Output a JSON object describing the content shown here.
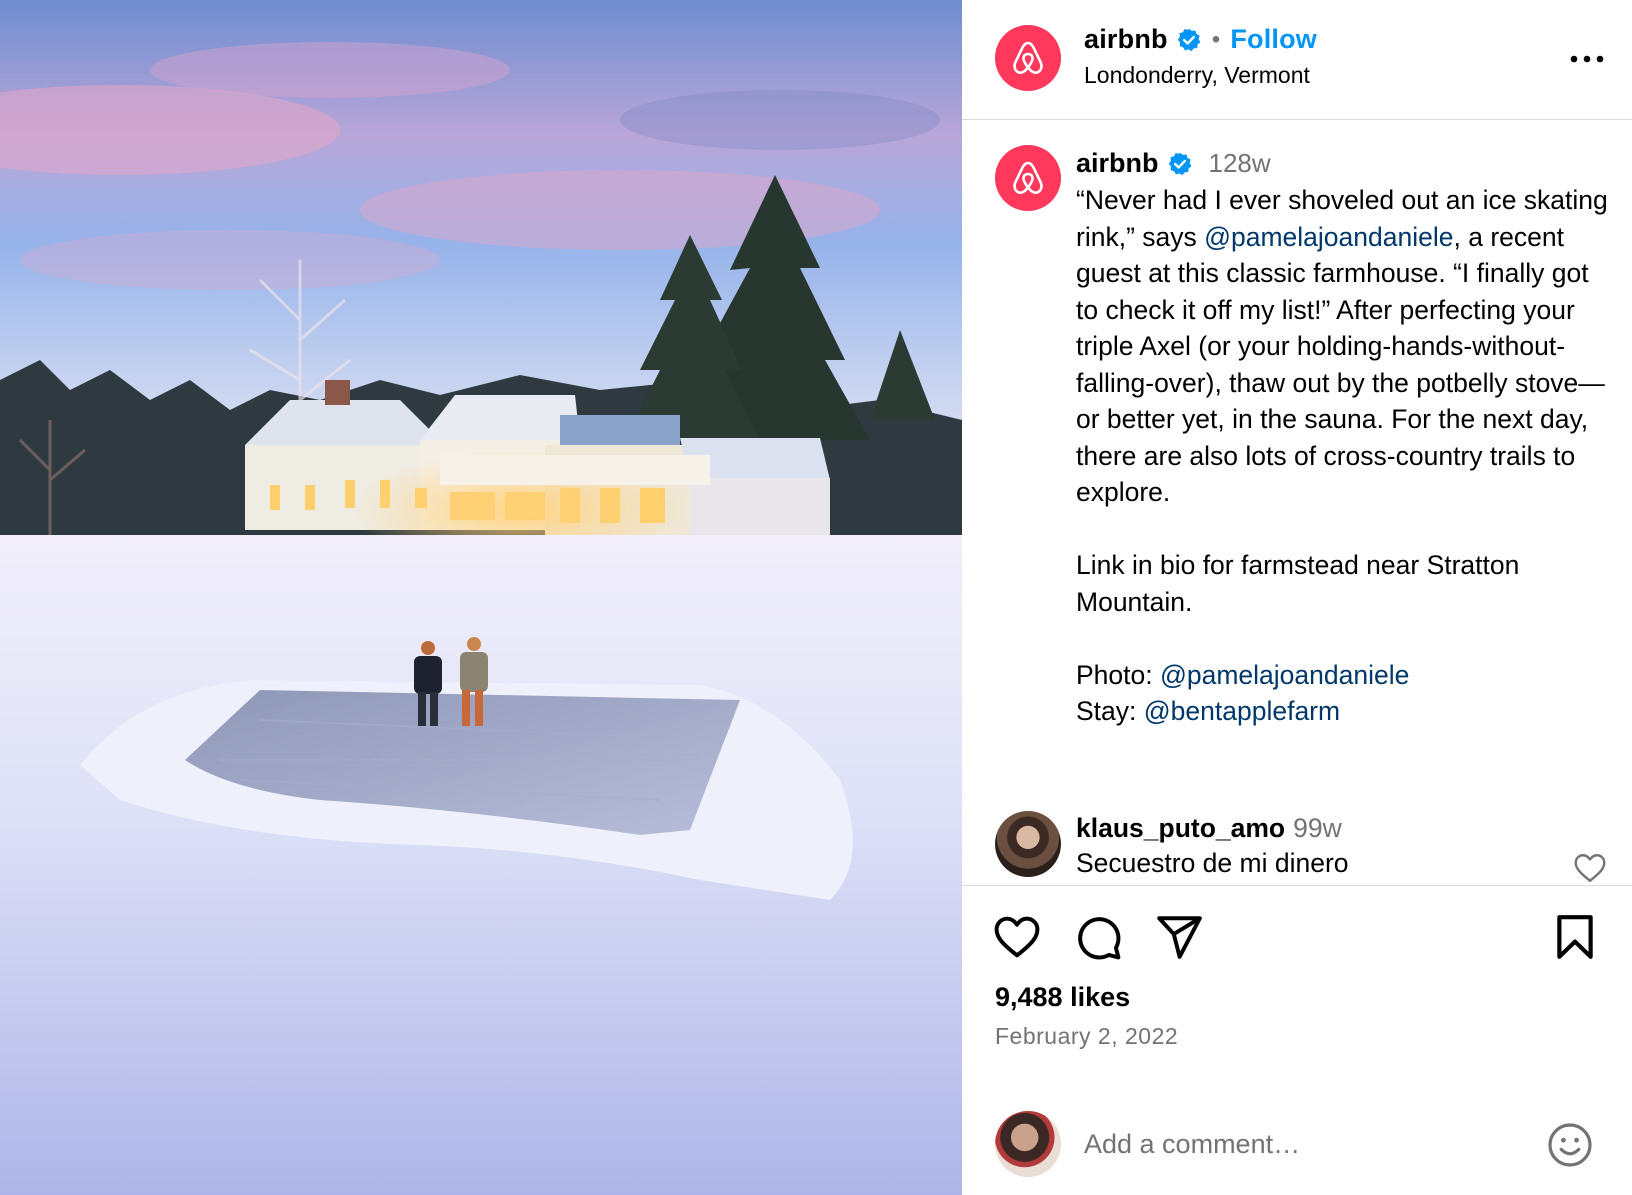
{
  "post": {
    "account": "airbnb",
    "follow_label": "Follow",
    "location": "Londonderry, Vermont",
    "separator": "•"
  },
  "caption": {
    "account": "airbnb",
    "time": "128w",
    "text_part1": "“Never had I ever shoveled out an ice skating rink,” says ",
    "mention1": "@pamelajoandaniele",
    "text_part2": ", a recent guest at this classic farmhouse. “I finally got to check it off my list!” After perfecting your triple Axel (or your holding-hands-without-falling-over), thaw out by the potbelly stove—or better yet, in the sauna. For the next day, there are also lots of cross-country trails to explore.\n\nLink in bio for farmstead near Stratton Mountain.\n\nPhoto: ",
    "mention2": "@pamelajoandaniele",
    "text_part3": "\nStay: ",
    "mention3": "@bentapplefarm"
  },
  "comment": {
    "user": "klaus_puto_amo",
    "time": "99w",
    "text": "Secuestro de mi dinero"
  },
  "stats": {
    "likes": "9,488 likes",
    "date": "February 2, 2022"
  },
  "composer": {
    "placeholder": "Add a comment…"
  },
  "colors": {
    "brand": "#ff385c",
    "link_blue": "#0095f6",
    "mention": "#00376b",
    "muted": "#737373"
  },
  "icons": {
    "header_more": "more-icon",
    "verified": "verified-badge-icon",
    "like": "heart-icon",
    "comment": "comment-icon",
    "share": "share-icon",
    "save": "bookmark-icon",
    "emoji": "emoji-icon"
  }
}
